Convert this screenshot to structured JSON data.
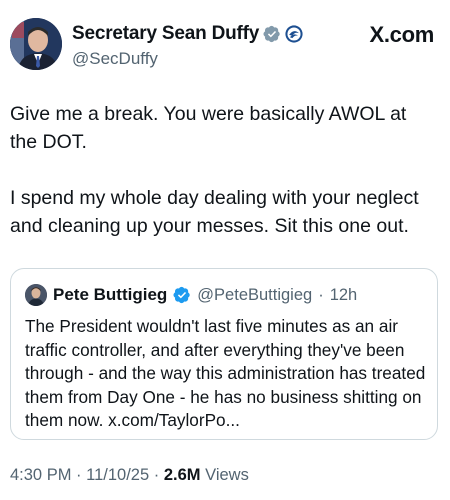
{
  "author": {
    "display_name": "Secretary Sean Duffy",
    "handle": "@SecDuffy",
    "verified_icon": "gray-verified-badge-icon",
    "affiliation_icon": "dot-agency-seal-icon"
  },
  "brand": {
    "watermark": "X.com"
  },
  "tweet": {
    "paragraphs": [
      "Give me a break. You were basically AWOL at the DOT.",
      "I spend my whole day dealing with your neglect and cleaning up your messes. Sit this one out."
    ]
  },
  "quoted": {
    "display_name": "Pete Buttigieg",
    "handle": "@PeteButtigieg",
    "separator": "·",
    "time": "12h",
    "verified_icon": "blue-verified-badge-icon",
    "text": "The President wouldn't last five minutes as an air traffic controller, and after everything they've been through - and the way this administration has treated them from Day One - he has no business shitting on them now. x.com/TaylorPo..."
  },
  "meta": {
    "time": "4:30 PM",
    "sep1": "·",
    "date": "11/10/25",
    "sep2": "·",
    "views_count": "2.6M",
    "views_label": "Views"
  },
  "colors": {
    "text": "#0f1419",
    "secondary": "#536471",
    "border": "#cfd9de",
    "verified_blue": "#1d9bf0",
    "verified_gray": "#829aab"
  }
}
